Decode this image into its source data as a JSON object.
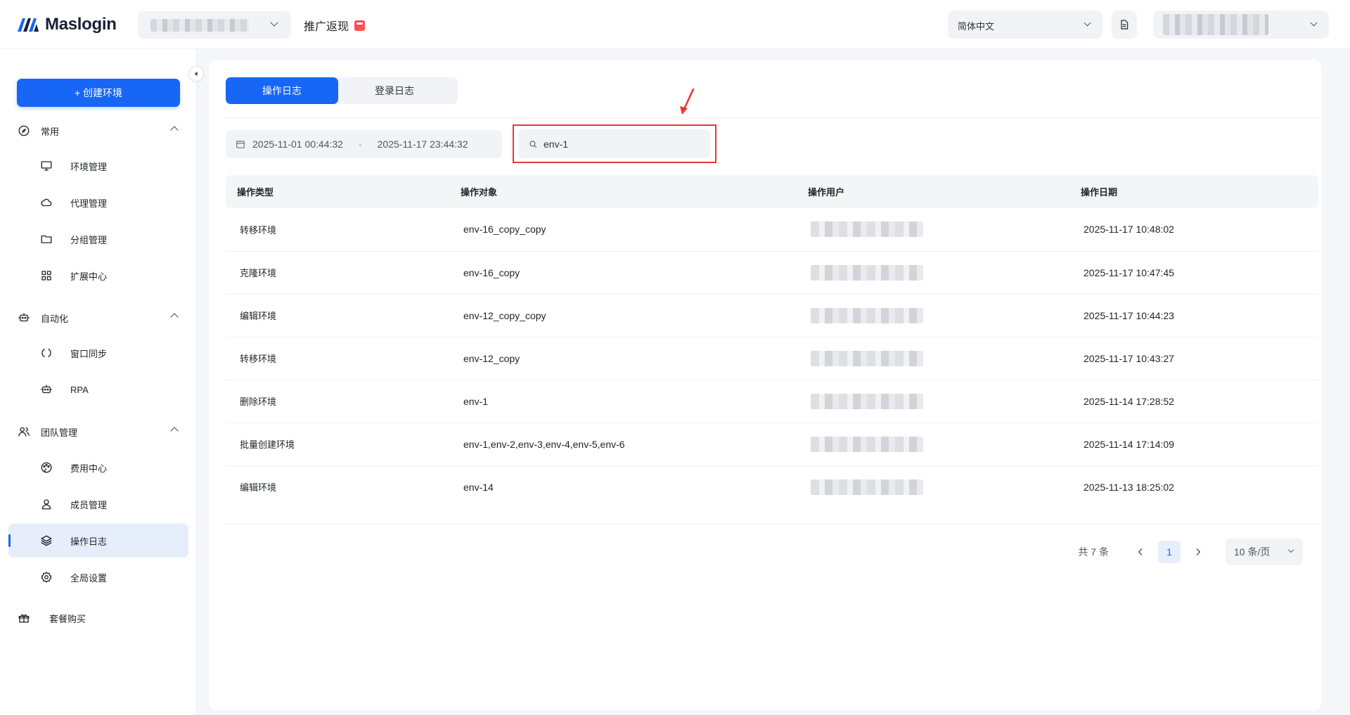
{
  "header": {
    "logo_text": "Maslogin",
    "promo": "推广返现",
    "language": "简体中文"
  },
  "sidebar": {
    "create_button": "+ 创建环境",
    "groups": {
      "common": "常用",
      "automation": "自动化",
      "team": "团队管理"
    },
    "items": {
      "env": "环境管理",
      "proxy": "代理管理",
      "group": "分组管理",
      "ext": "扩展中心",
      "sync": "窗口同步",
      "rpa": "RPA",
      "billing": "费用中心",
      "members": "成员管理",
      "oplog": "操作日志",
      "settings": "全局设置"
    },
    "plan": "套餐购买"
  },
  "main": {
    "tabs": [
      "操作日志",
      "登录日志"
    ],
    "date_start": "2025-11-01 00:44:32",
    "date_sep": "-",
    "date_end": "2025-11-17 23:44:32",
    "search_value": "env-1",
    "columns": [
      "操作类型",
      "操作对象",
      "操作用户",
      "操作日期"
    ],
    "rows": [
      {
        "type": "转移环境",
        "target": "env-16_copy_copy",
        "date": "2025-11-17 10:48:02"
      },
      {
        "type": "克隆环境",
        "target": "env-16_copy",
        "date": "2025-11-17 10:47:45"
      },
      {
        "type": "编辑环境",
        "target": "env-12_copy_copy",
        "date": "2025-11-17 10:44:23"
      },
      {
        "type": "转移环境",
        "target": "env-12_copy",
        "date": "2025-11-17 10:43:27"
      },
      {
        "type": "删除环境",
        "target": "env-1",
        "date": "2025-11-14 17:28:52"
      },
      {
        "type": "批量创建环境",
        "target": "env-1,env-2,env-3,env-4,env-5,env-6",
        "date": "2025-11-14 17:14:09"
      },
      {
        "type": "编辑环境",
        "target": "env-14",
        "date": "2025-11-13 18:25:02"
      }
    ],
    "pagination": {
      "total": "共 7 条",
      "current_page": "1",
      "page_size": "10 条/页"
    }
  },
  "colors": {
    "primary": "#1766f5",
    "highlight_box": "#e53935",
    "active_bg": "#e6eefc"
  }
}
